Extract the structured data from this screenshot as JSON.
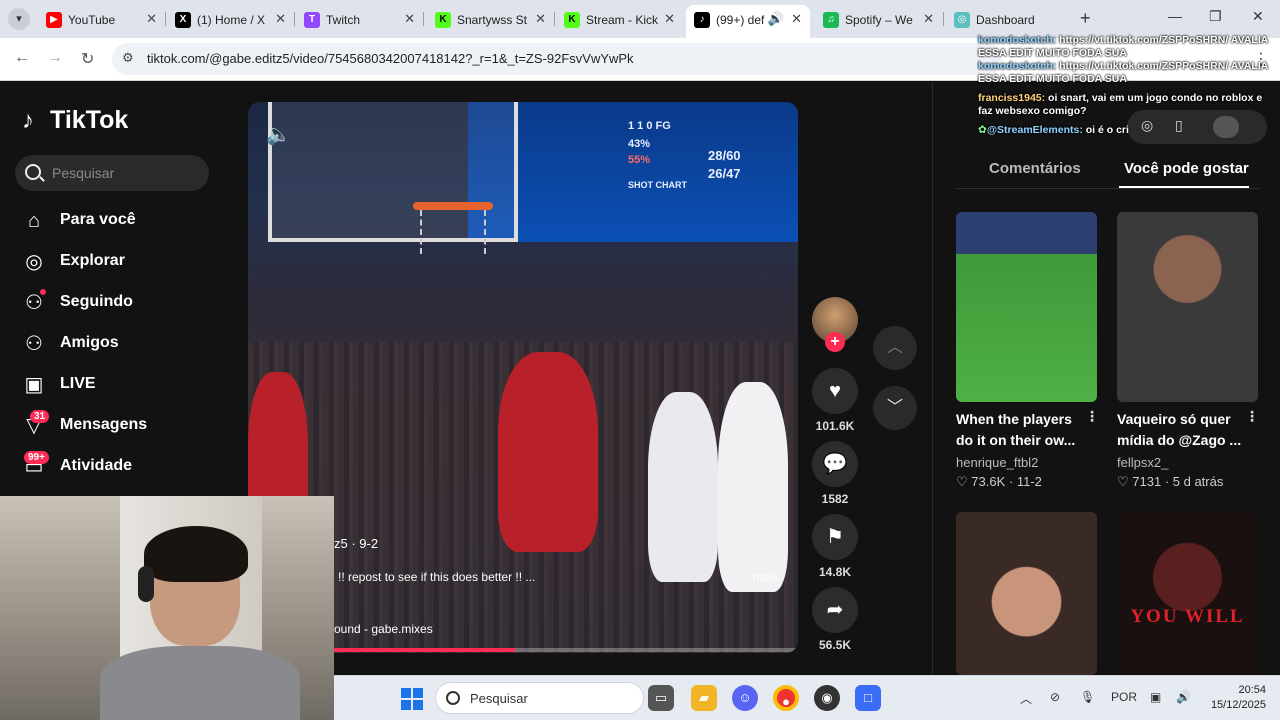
{
  "browser": {
    "tabs": [
      {
        "label": "YouTube",
        "fav": "▶",
        "color": "#ff0000"
      },
      {
        "label": "(1) Home / X",
        "fav": "X",
        "color": "#000000"
      },
      {
        "label": "Twitch",
        "fav": "T",
        "color": "#9146ff"
      },
      {
        "label": "Snartywss St",
        "fav": "K",
        "color": "#53fc18"
      },
      {
        "label": "Stream - Kick",
        "fav": "K",
        "color": "#53fc18"
      },
      {
        "label": "(99+) def",
        "fav": "♪",
        "color": "#000000"
      },
      {
        "label": "Spotify – We",
        "fav": "♫",
        "color": "#1db954"
      },
      {
        "label": "Dashboard",
        "fav": "◎",
        "color": "#5bc0be"
      }
    ],
    "url": "tiktok.com/@gabe.editz5/video/7545680342007418142?_r=1&_t=ZS-92FsvVwYwPk"
  },
  "tiktok": {
    "logo": "TikTok",
    "search_placeholder": "Pesquisar",
    "nav": [
      {
        "label": "Para você",
        "icon": "home-icon",
        "glyph": "⌂"
      },
      {
        "label": "Explorar",
        "icon": "compass-icon",
        "glyph": "◎"
      },
      {
        "label": "Seguindo",
        "icon": "following-icon",
        "glyph": "⚇"
      },
      {
        "label": "Amigos",
        "icon": "friends-icon",
        "glyph": "⚇"
      },
      {
        "label": "LIVE",
        "icon": "live-icon",
        "glyph": "▣"
      },
      {
        "label": "Mensagens",
        "icon": "messages-icon",
        "glyph": "▽",
        "badge": "31"
      },
      {
        "label": "Atividade",
        "icon": "activity-icon",
        "glyph": "▭",
        "badge": "99+"
      }
    ],
    "video": {
      "author_date": "z5 · 9-2",
      "caption": "!! repost to see if this does better !! ...",
      "more": "mais",
      "sound": "ound - gabe.mixes",
      "progress": 0.39,
      "scoreboard": [
        "1 1 0 FG",
        "43%",
        "55%",
        "28/60",
        "26/47",
        "SHOT CHART"
      ]
    },
    "actions": {
      "likes": "101.6K",
      "comments": "1582",
      "saves": "14.8K",
      "shares": "56.5K"
    },
    "panel": {
      "tab_comments": "Comentários",
      "tab_suggested": "Você pode gostar",
      "cards": [
        {
          "title": "When the players do it on their ow...",
          "user": "henrique_ftbl2",
          "likes": "73.6K",
          "date": "11-2"
        },
        {
          "title": "Vaqueiro só quer mídia do @Zago ...",
          "user": "fellpsx2_",
          "likes": "7131",
          "date": "5 d atrás"
        },
        {
          "title": "",
          "user": "",
          "likes": "",
          "date": ""
        },
        {
          "title": "",
          "user": "",
          "likes": "",
          "overlay": "YOU WILL"
        }
      ]
    }
  },
  "chat": [
    {
      "name": "komodoskotch:",
      "text": " https://vt.tiktok.com/ZSPPoSHRN/ AVALIA ESSA EDIT MUITO FODA SUA"
    },
    {
      "name": "komodoskotch:",
      "text": " https://vt.tiktok.com/ZSPPoSHRN/ AVALIA ESSA EDIT MUITO FODA SUA"
    },
    {
      "name": "franciss1945:",
      "text": " oi snart, vai em um jogo condo no roblox e faz websexo comigo?"
    },
    {
      "name": "@StreamElements:",
      "text": " oi é o cri"
    }
  ],
  "taskbar": {
    "search_placeholder": "Pesquisar",
    "lang": "POR",
    "time": "20:54",
    "date": "15/12/2025"
  }
}
